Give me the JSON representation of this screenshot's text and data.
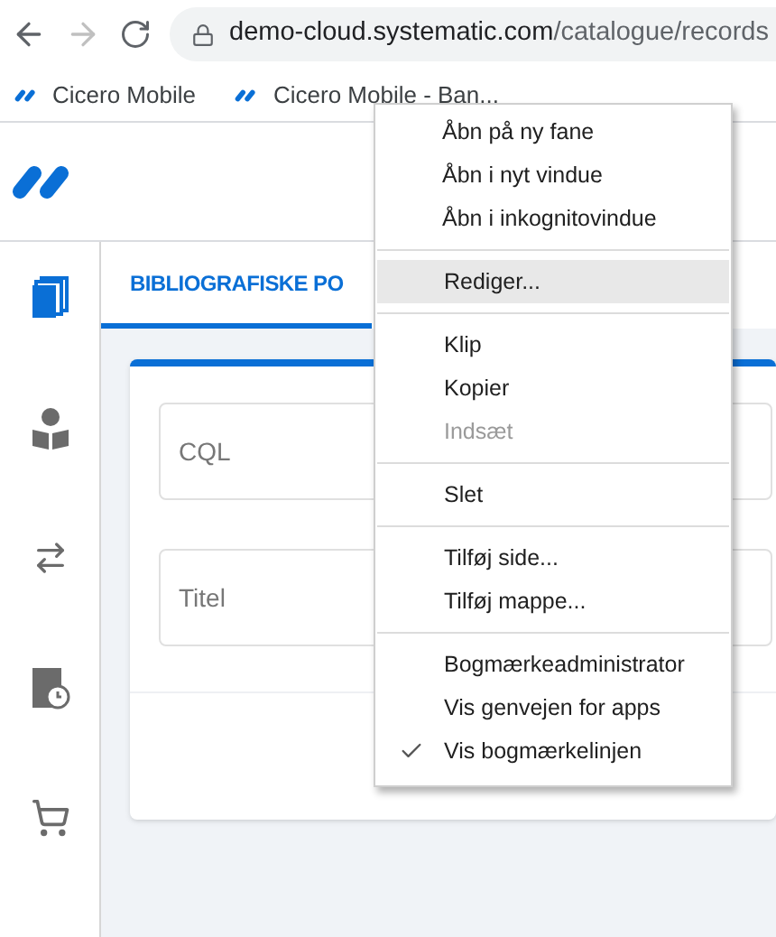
{
  "browser": {
    "back_disabled": false,
    "forward_disabled": true,
    "url_host": "demo-cloud.systematic.com",
    "url_path": "/catalogue/records"
  },
  "bookmarks": [
    {
      "label": "Cicero Mobile"
    },
    {
      "label": "Cicero Mobile - Ban..."
    }
  ],
  "sidebar": {
    "items": [
      {
        "kind": "books",
        "selected": true
      },
      {
        "kind": "reader",
        "selected": false
      },
      {
        "kind": "transfer",
        "selected": false
      },
      {
        "kind": "history",
        "selected": false
      },
      {
        "kind": "cart",
        "selected": false
      }
    ]
  },
  "tabs": [
    {
      "label": "BIBLIOGRAFISKE PO",
      "selected": true
    }
  ],
  "fields": [
    {
      "placeholder": "CQL"
    },
    {
      "placeholder": "Titel"
    }
  ],
  "context_menu": {
    "groups": [
      [
        {
          "label": "Åbn på ny fane",
          "selected": false,
          "disabled": false,
          "checked": false
        },
        {
          "label": "Åbn i nyt vindue",
          "selected": false,
          "disabled": false,
          "checked": false
        },
        {
          "label": "Åbn i inkognitovindue",
          "selected": false,
          "disabled": false,
          "checked": false
        }
      ],
      [
        {
          "label": "Rediger...",
          "selected": true,
          "disabled": false,
          "checked": false
        }
      ],
      [
        {
          "label": "Klip",
          "selected": false,
          "disabled": false,
          "checked": false
        },
        {
          "label": "Kopier",
          "selected": false,
          "disabled": false,
          "checked": false
        },
        {
          "label": "Indsæt",
          "selected": false,
          "disabled": true,
          "checked": false
        }
      ],
      [
        {
          "label": "Slet",
          "selected": false,
          "disabled": false,
          "checked": false
        }
      ],
      [
        {
          "label": "Tilføj side...",
          "selected": false,
          "disabled": false,
          "checked": false
        },
        {
          "label": "Tilføj mappe...",
          "selected": false,
          "disabled": false,
          "checked": false
        }
      ],
      [
        {
          "label": "Bogmærkeadministrator",
          "selected": false,
          "disabled": false,
          "checked": false
        },
        {
          "label": "Vis genvejen for apps",
          "selected": false,
          "disabled": false,
          "checked": false
        },
        {
          "label": "Vis bogmærkelinjen",
          "selected": false,
          "disabled": false,
          "checked": true
        }
      ]
    ]
  }
}
